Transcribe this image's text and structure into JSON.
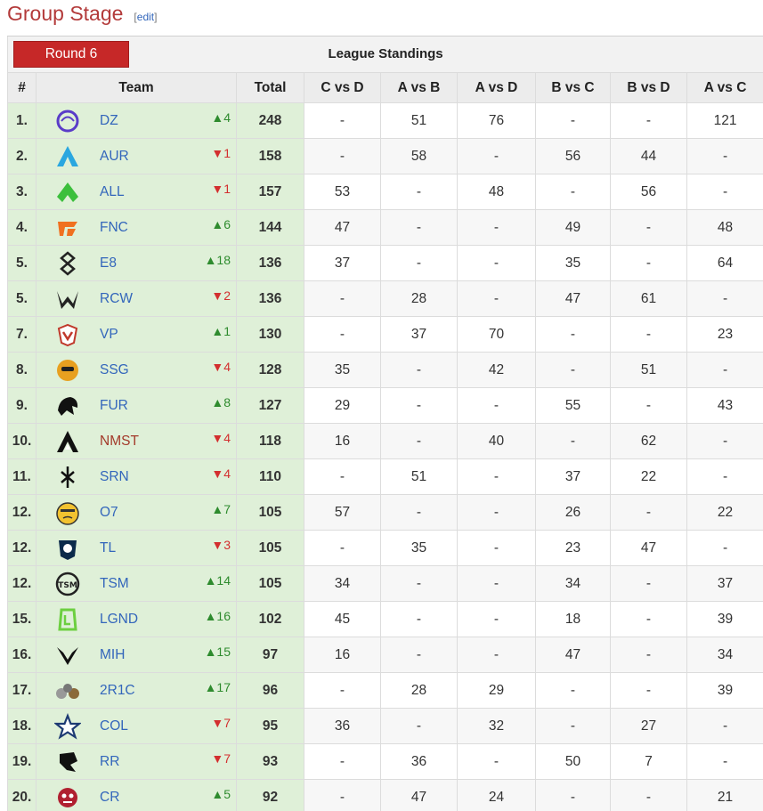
{
  "section": {
    "title": "Group Stage",
    "edit_label": "edit"
  },
  "table": {
    "round_label": "Round 6",
    "title": "League Standings",
    "headers": [
      "#",
      "Team",
      "Total",
      "C vs D",
      "A vs B",
      "A vs D",
      "B vs C",
      "B vs D",
      "A vs C"
    ],
    "rows": [
      {
        "rank": "1.",
        "team": "DZ",
        "arrow": "▲",
        "delta": "4",
        "dir": "up",
        "total": "248",
        "scores": [
          "-",
          "51",
          "76",
          "-",
          "-",
          "121"
        ],
        "logo": "dz-logo-icon",
        "logo_color": "#5a3cc8"
      },
      {
        "rank": "2.",
        "team": "AUR",
        "arrow": "▼",
        "delta": "1",
        "dir": "down",
        "total": "158",
        "scores": [
          "-",
          "58",
          "-",
          "56",
          "44",
          "-"
        ],
        "logo": "aur-logo-icon",
        "logo_color": "#2aa7e0"
      },
      {
        "rank": "3.",
        "team": "ALL",
        "arrow": "▼",
        "delta": "1",
        "dir": "down",
        "total": "157",
        "scores": [
          "53",
          "-",
          "48",
          "-",
          "56",
          "-"
        ],
        "logo": "all-logo-icon",
        "logo_color": "#3cbf3c"
      },
      {
        "rank": "4.",
        "team": "FNC",
        "arrow": "▲",
        "delta": "6",
        "dir": "up",
        "total": "144",
        "scores": [
          "47",
          "-",
          "-",
          "49",
          "-",
          "48"
        ],
        "logo": "fnc-logo-icon",
        "logo_color": "#f07020"
      },
      {
        "rank": "5.",
        "team": "E8",
        "arrow": "▲",
        "delta": "18",
        "dir": "up",
        "total": "136",
        "scores": [
          "37",
          "-",
          "-",
          "35",
          "-",
          "64"
        ],
        "logo": "e8-logo-icon",
        "logo_color": "#222222"
      },
      {
        "rank": "5.",
        "team": "RCW",
        "arrow": "▼",
        "delta": "2",
        "dir": "down",
        "total": "136",
        "scores": [
          "-",
          "28",
          "-",
          "47",
          "61",
          "-"
        ],
        "logo": "rcw-logo-icon",
        "logo_color": "#222222"
      },
      {
        "rank": "7.",
        "team": "VP",
        "arrow": "▲",
        "delta": "1",
        "dir": "up",
        "total": "130",
        "scores": [
          "-",
          "37",
          "70",
          "-",
          "-",
          "23"
        ],
        "logo": "vp-logo-icon",
        "logo_color": "#c0392b"
      },
      {
        "rank": "8.",
        "team": "SSG",
        "arrow": "▼",
        "delta": "4",
        "dir": "down",
        "total": "128",
        "scores": [
          "35",
          "-",
          "42",
          "-",
          "51",
          "-"
        ],
        "logo": "ssg-logo-icon",
        "logo_color": "#e8a020"
      },
      {
        "rank": "9.",
        "team": "FUR",
        "arrow": "▲",
        "delta": "8",
        "dir": "up",
        "total": "127",
        "scores": [
          "29",
          "-",
          "-",
          "55",
          "-",
          "43"
        ],
        "logo": "fur-logo-icon",
        "logo_color": "#111111"
      },
      {
        "rank": "10.",
        "team": "NMST",
        "arrow": "▼",
        "delta": "4",
        "dir": "down",
        "total": "118",
        "scores": [
          "16",
          "-",
          "40",
          "-",
          "62",
          "-"
        ],
        "logo": "nmst-logo-icon",
        "logo_color": "#111111",
        "name_red": true
      },
      {
        "rank": "11.",
        "team": "SRN",
        "arrow": "▼",
        "delta": "4",
        "dir": "down",
        "total": "110",
        "scores": [
          "-",
          "51",
          "-",
          "37",
          "22",
          "-"
        ],
        "logo": "srn-logo-icon",
        "logo_color": "#111111"
      },
      {
        "rank": "12.",
        "team": "O7",
        "arrow": "▲",
        "delta": "7",
        "dir": "up",
        "total": "105",
        "scores": [
          "57",
          "-",
          "-",
          "26",
          "-",
          "22"
        ],
        "logo": "o7-logo-icon",
        "logo_color": "#f2c230"
      },
      {
        "rank": "12.",
        "team": "TL",
        "arrow": "▼",
        "delta": "3",
        "dir": "down",
        "total": "105",
        "scores": [
          "-",
          "35",
          "-",
          "23",
          "47",
          "-"
        ],
        "logo": "tl-logo-icon",
        "logo_color": "#0b2a4a"
      },
      {
        "rank": "12.",
        "team": "TSM",
        "arrow": "▲",
        "delta": "14",
        "dir": "up",
        "total": "105",
        "scores": [
          "34",
          "-",
          "-",
          "34",
          "-",
          "37"
        ],
        "logo": "tsm-logo-icon",
        "logo_color": "#222222"
      },
      {
        "rank": "15.",
        "team": "LGND",
        "arrow": "▲",
        "delta": "16",
        "dir": "up",
        "total": "102",
        "scores": [
          "45",
          "-",
          "-",
          "18",
          "-",
          "39"
        ],
        "logo": "lgnd-logo-icon",
        "logo_color": "#6ccf40"
      },
      {
        "rank": "16.",
        "team": "MIH",
        "arrow": "▲",
        "delta": "15",
        "dir": "up",
        "total": "97",
        "scores": [
          "16",
          "-",
          "-",
          "47",
          "-",
          "34"
        ],
        "logo": "mih-logo-icon",
        "logo_color": "#111111"
      },
      {
        "rank": "17.",
        "team": "2R1C",
        "arrow": "▲",
        "delta": "17",
        "dir": "up",
        "total": "96",
        "scores": [
          "-",
          "28",
          "29",
          "-",
          "-",
          "39"
        ],
        "logo": "2r1c-logo-icon",
        "logo_color": "#8a6a3a"
      },
      {
        "rank": "18.",
        "team": "COL",
        "arrow": "▼",
        "delta": "7",
        "dir": "down",
        "total": "95",
        "scores": [
          "36",
          "-",
          "32",
          "-",
          "27",
          "-"
        ],
        "logo": "col-logo-icon",
        "logo_color": "#1d3a73"
      },
      {
        "rank": "19.",
        "team": "RR",
        "arrow": "▼",
        "delta": "7",
        "dir": "down",
        "total": "93",
        "scores": [
          "-",
          "36",
          "-",
          "50",
          "7",
          "-"
        ],
        "logo": "rr-logo-icon",
        "logo_color": "#111111"
      },
      {
        "rank": "20.",
        "team": "CR",
        "arrow": "▲",
        "delta": "5",
        "dir": "up",
        "total": "92",
        "scores": [
          "-",
          "47",
          "24",
          "-",
          "-",
          "21"
        ],
        "logo": "cr-logo-icon",
        "logo_color": "#b02030"
      }
    ]
  },
  "colors": {
    "accent_red": "#c62828",
    "row_green": "#dff0d8",
    "link_blue": "#3366bb",
    "up_green": "#2e8b2e",
    "down_red": "#d32f2f"
  }
}
